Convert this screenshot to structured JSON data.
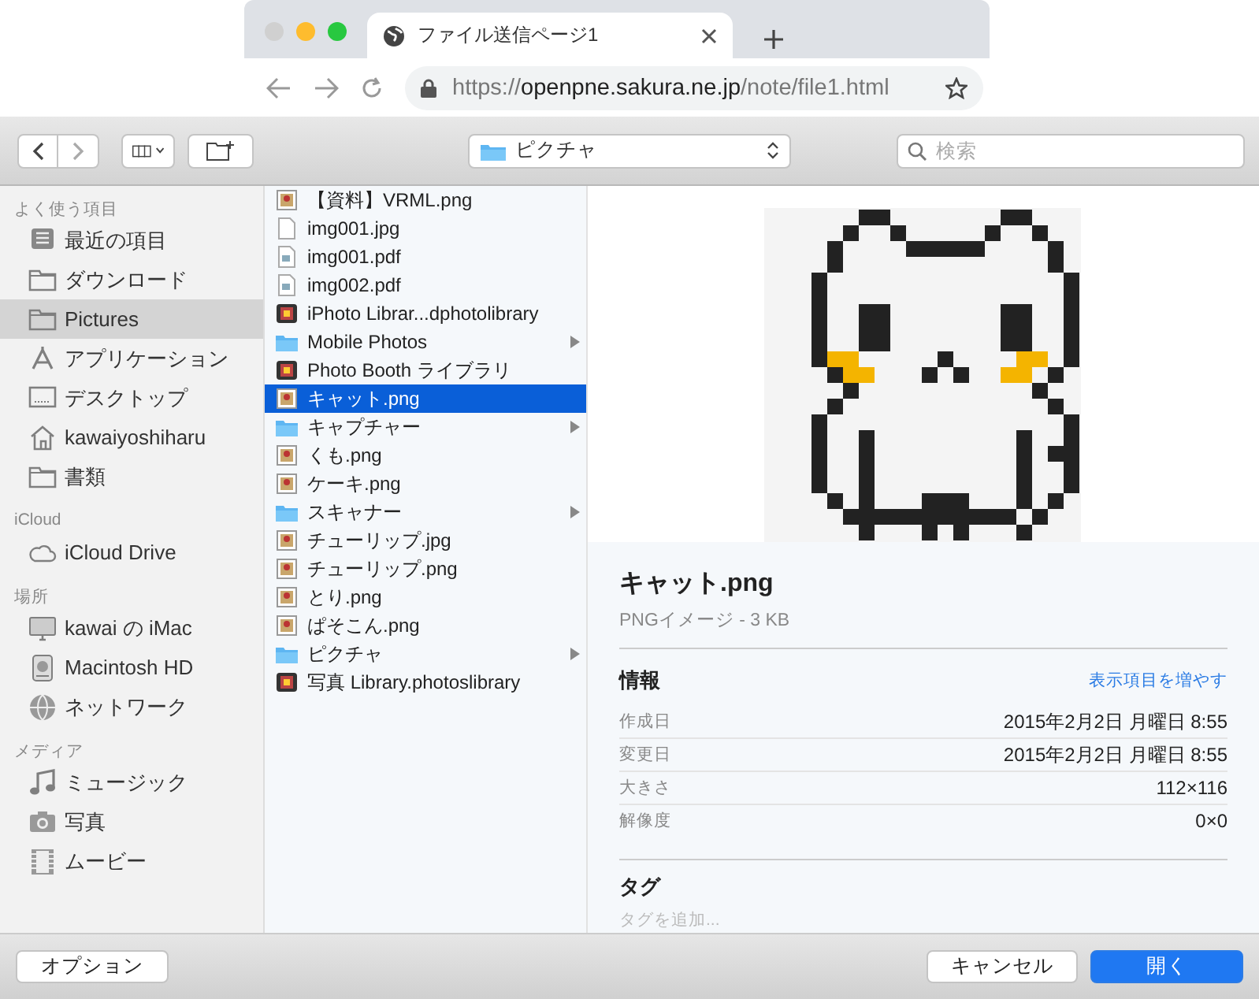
{
  "browser": {
    "tab": {
      "title": "ファイル送信ページ1"
    },
    "url": {
      "scheme": "https://",
      "host": "openpne.sakura.ne.jp",
      "path": "/note/file1.html"
    }
  },
  "toolbar": {
    "location": "ピクチャ",
    "search": {
      "placeholder": "検索"
    }
  },
  "sidebar": [
    {
      "heading": "よく使う項目",
      "items": [
        {
          "label": "最近の項目",
          "kind": "recents",
          "selected": false
        },
        {
          "label": "ダウンロード",
          "kind": "folder",
          "selected": false
        },
        {
          "label": "Pictures",
          "kind": "folder",
          "selected": true
        },
        {
          "label": "アプリケーション",
          "kind": "apps",
          "selected": false
        },
        {
          "label": "デスクトップ",
          "kind": "desktop",
          "selected": false
        },
        {
          "label": "kawaiyoshiharu",
          "kind": "home",
          "selected": false
        },
        {
          "label": "書類",
          "kind": "folder",
          "selected": false
        }
      ]
    },
    {
      "heading": "iCloud",
      "items": [
        {
          "label": "iCloud Drive",
          "kind": "cloud",
          "selected": false
        }
      ]
    },
    {
      "heading": "場所",
      "items": [
        {
          "label": "kawai の iMac",
          "kind": "computer",
          "selected": false
        },
        {
          "label": "Macintosh HD",
          "kind": "disk",
          "selected": false
        },
        {
          "label": "ネットワーク",
          "kind": "network",
          "selected": false
        }
      ]
    },
    {
      "heading": "メディア",
      "items": [
        {
          "label": "ミュージック",
          "kind": "music",
          "selected": false
        },
        {
          "label": "写真",
          "kind": "camera",
          "selected": false
        },
        {
          "label": "ムービー",
          "kind": "film",
          "selected": false
        }
      ]
    }
  ],
  "files": [
    {
      "name": "【資料】VRML.png",
      "kind": "image",
      "selected": false
    },
    {
      "name": "img001.jpg",
      "kind": "blank",
      "selected": false
    },
    {
      "name": "img001.pdf",
      "kind": "pdf",
      "selected": false
    },
    {
      "name": "img002.pdf",
      "kind": "pdf",
      "selected": false
    },
    {
      "name": "iPhoto Librar...dphotolibrary",
      "kind": "library",
      "selected": false
    },
    {
      "name": "Mobile Photos",
      "kind": "folder",
      "selected": false
    },
    {
      "name": "Photo Booth ライブラリ",
      "kind": "library",
      "selected": false
    },
    {
      "name": "キャット.png",
      "kind": "image",
      "selected": true
    },
    {
      "name": "キャプチャー",
      "kind": "folder",
      "selected": false
    },
    {
      "name": "くも.png",
      "kind": "image",
      "selected": false
    },
    {
      "name": "ケーキ.png",
      "kind": "image",
      "selected": false
    },
    {
      "name": "スキャナー",
      "kind": "folder",
      "selected": false
    },
    {
      "name": "チューリップ.jpg",
      "kind": "image",
      "selected": false
    },
    {
      "name": "チューリップ.png",
      "kind": "image",
      "selected": false
    },
    {
      "name": "とり.png",
      "kind": "image",
      "selected": false
    },
    {
      "name": "ぱそこん.png",
      "kind": "image",
      "selected": false
    },
    {
      "name": "ピクチャ",
      "kind": "folder",
      "selected": false
    },
    {
      "name": "写真 Library.photoslibrary",
      "kind": "library",
      "selected": false
    }
  ],
  "preview": {
    "name": "キャット.png",
    "subtitle": "PNGイメージ - 3 KB",
    "info": {
      "heading": "情報",
      "more_link": "表示項目を増やす",
      "rows": [
        {
          "label": "作成日",
          "value": "2015年2月2日 月曜日 8:55"
        },
        {
          "label": "変更日",
          "value": "2015年2月2日 月曜日 8:55"
        },
        {
          "label": "大きさ",
          "value": "112×116"
        },
        {
          "label": "解像度",
          "value": "0×0"
        }
      ]
    },
    "tags": {
      "heading": "タグ",
      "placeholder": "タグを追加..."
    }
  },
  "buttons": {
    "options": "オプション",
    "cancel": "キャンセル",
    "open": "開く"
  }
}
